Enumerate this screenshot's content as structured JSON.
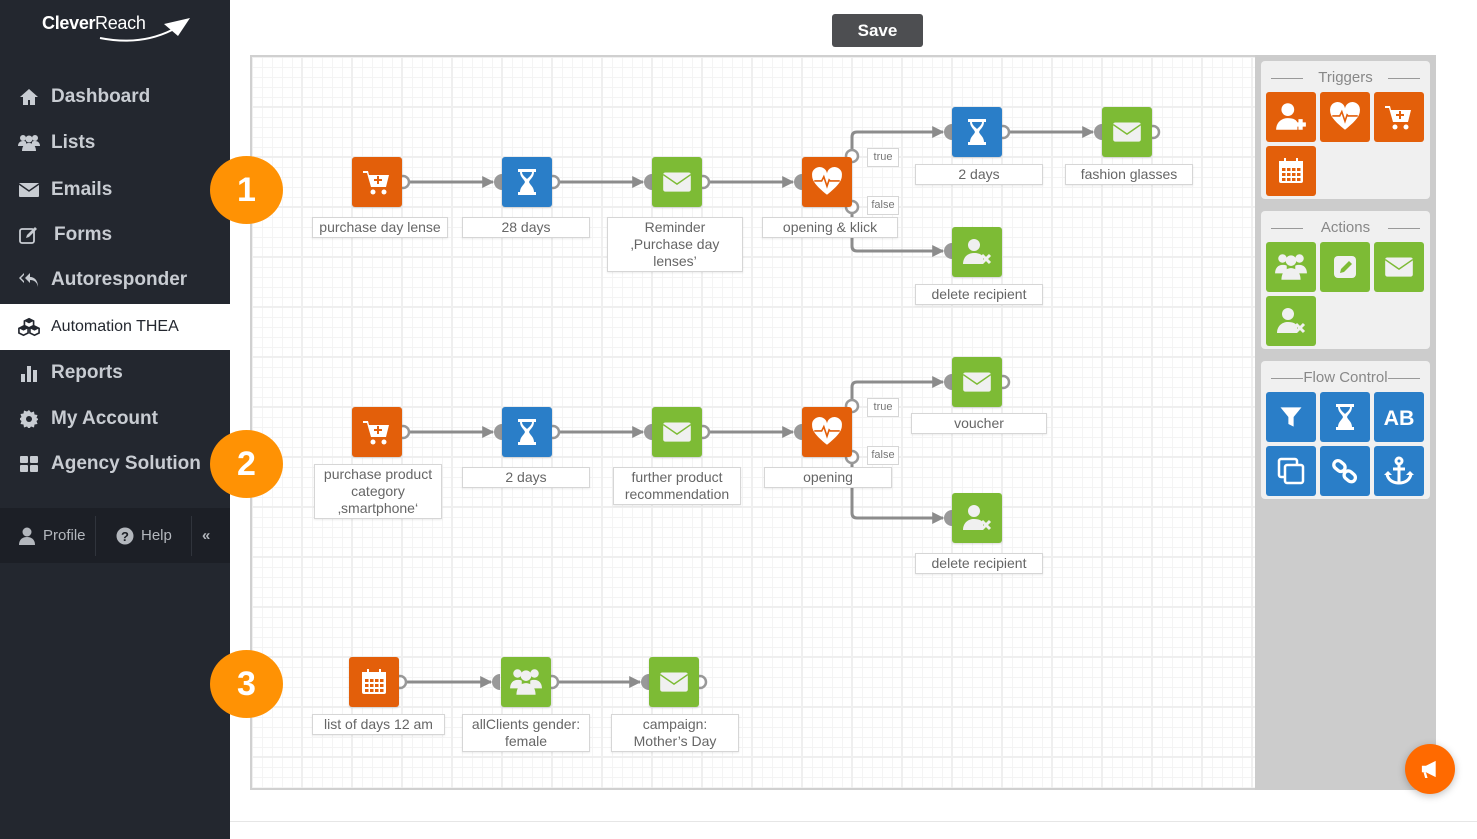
{
  "app": {
    "brand_bold": "Clever",
    "brand_regular": "Reach"
  },
  "toolbar": {
    "save_label": "Save"
  },
  "sidebar": {
    "items": [
      {
        "label": "Dashboard",
        "icon": "home-icon"
      },
      {
        "label": "Lists",
        "icon": "users-icon"
      },
      {
        "label": "Emails",
        "icon": "envelope-icon"
      },
      {
        "label": "Forms",
        "icon": "edit-icon"
      },
      {
        "label": "Autoresponder",
        "icon": "reply-all-icon"
      },
      {
        "label": "Automation THEA",
        "icon": "cubes-icon",
        "active": true
      },
      {
        "label": "Reports",
        "icon": "bar-chart-icon"
      },
      {
        "label": "My Account",
        "icon": "gear-icon"
      },
      {
        "label": "Agency Solution",
        "icon": "grid-icon"
      }
    ],
    "bottom": {
      "profile": "Profile",
      "help": "Help",
      "collapse": "«"
    }
  },
  "palette": {
    "triggers": {
      "title": "Triggers",
      "items": [
        "add-recipient-trigger",
        "opening-trigger",
        "purchase-trigger",
        "date-trigger"
      ]
    },
    "actions": {
      "title": "Actions",
      "items": [
        "group-action",
        "edit-action",
        "email-action",
        "delete-recipient-action"
      ]
    },
    "flow_control": {
      "title": "Flow Control",
      "items": [
        "filter",
        "wait",
        "ab-split",
        "copy",
        "link",
        "anchor"
      ]
    }
  },
  "colors": {
    "trigger": "#e35f0a",
    "action": "#7dbb35",
    "flow": "#2a7ec8",
    "badge": "#ff9204",
    "sidebar": "#23272f"
  },
  "badges": [
    "1",
    "2",
    "3"
  ],
  "flows": [
    {
      "nodes": [
        {
          "type": "trigger",
          "icon": "cart-plus-icon",
          "label": "purchase day lense"
        },
        {
          "type": "flow",
          "icon": "hourglass-icon",
          "label": "28 days"
        },
        {
          "type": "action",
          "icon": "envelope-icon",
          "label": "Reminder ‚Purchase day lenses’"
        },
        {
          "type": "trigger",
          "icon": "heartbeat-icon",
          "label": "opening & klick"
        },
        {
          "type": "flow",
          "icon": "hourglass-icon",
          "label": "2 days"
        },
        {
          "type": "action",
          "icon": "envelope-icon",
          "label": "fashion glasses"
        },
        {
          "type": "action",
          "icon": "user-delete-icon",
          "label": "delete recipient"
        }
      ],
      "branch_labels": {
        "true": "true",
        "false": "false"
      }
    },
    {
      "nodes": [
        {
          "type": "trigger",
          "icon": "cart-plus-icon",
          "label": "purchase product category ‚smartphone‘"
        },
        {
          "type": "flow",
          "icon": "hourglass-icon",
          "label": "2 days"
        },
        {
          "type": "action",
          "icon": "envelope-icon",
          "label": "further product recommendation"
        },
        {
          "type": "trigger",
          "icon": "heartbeat-icon",
          "label": "opening"
        },
        {
          "type": "action",
          "icon": "envelope-icon",
          "label": "voucher"
        },
        {
          "type": "action",
          "icon": "user-delete-icon",
          "label": "delete recipient"
        }
      ],
      "branch_labels": {
        "true": "true",
        "false": "false"
      }
    },
    {
      "nodes": [
        {
          "type": "trigger",
          "icon": "calendar-icon",
          "label": "list of days 12 am"
        },
        {
          "type": "action",
          "icon": "group-icon",
          "label": "allClients gender: female"
        },
        {
          "type": "action",
          "icon": "envelope-icon",
          "label": "campaign: Mother’s Day"
        }
      ]
    }
  ]
}
